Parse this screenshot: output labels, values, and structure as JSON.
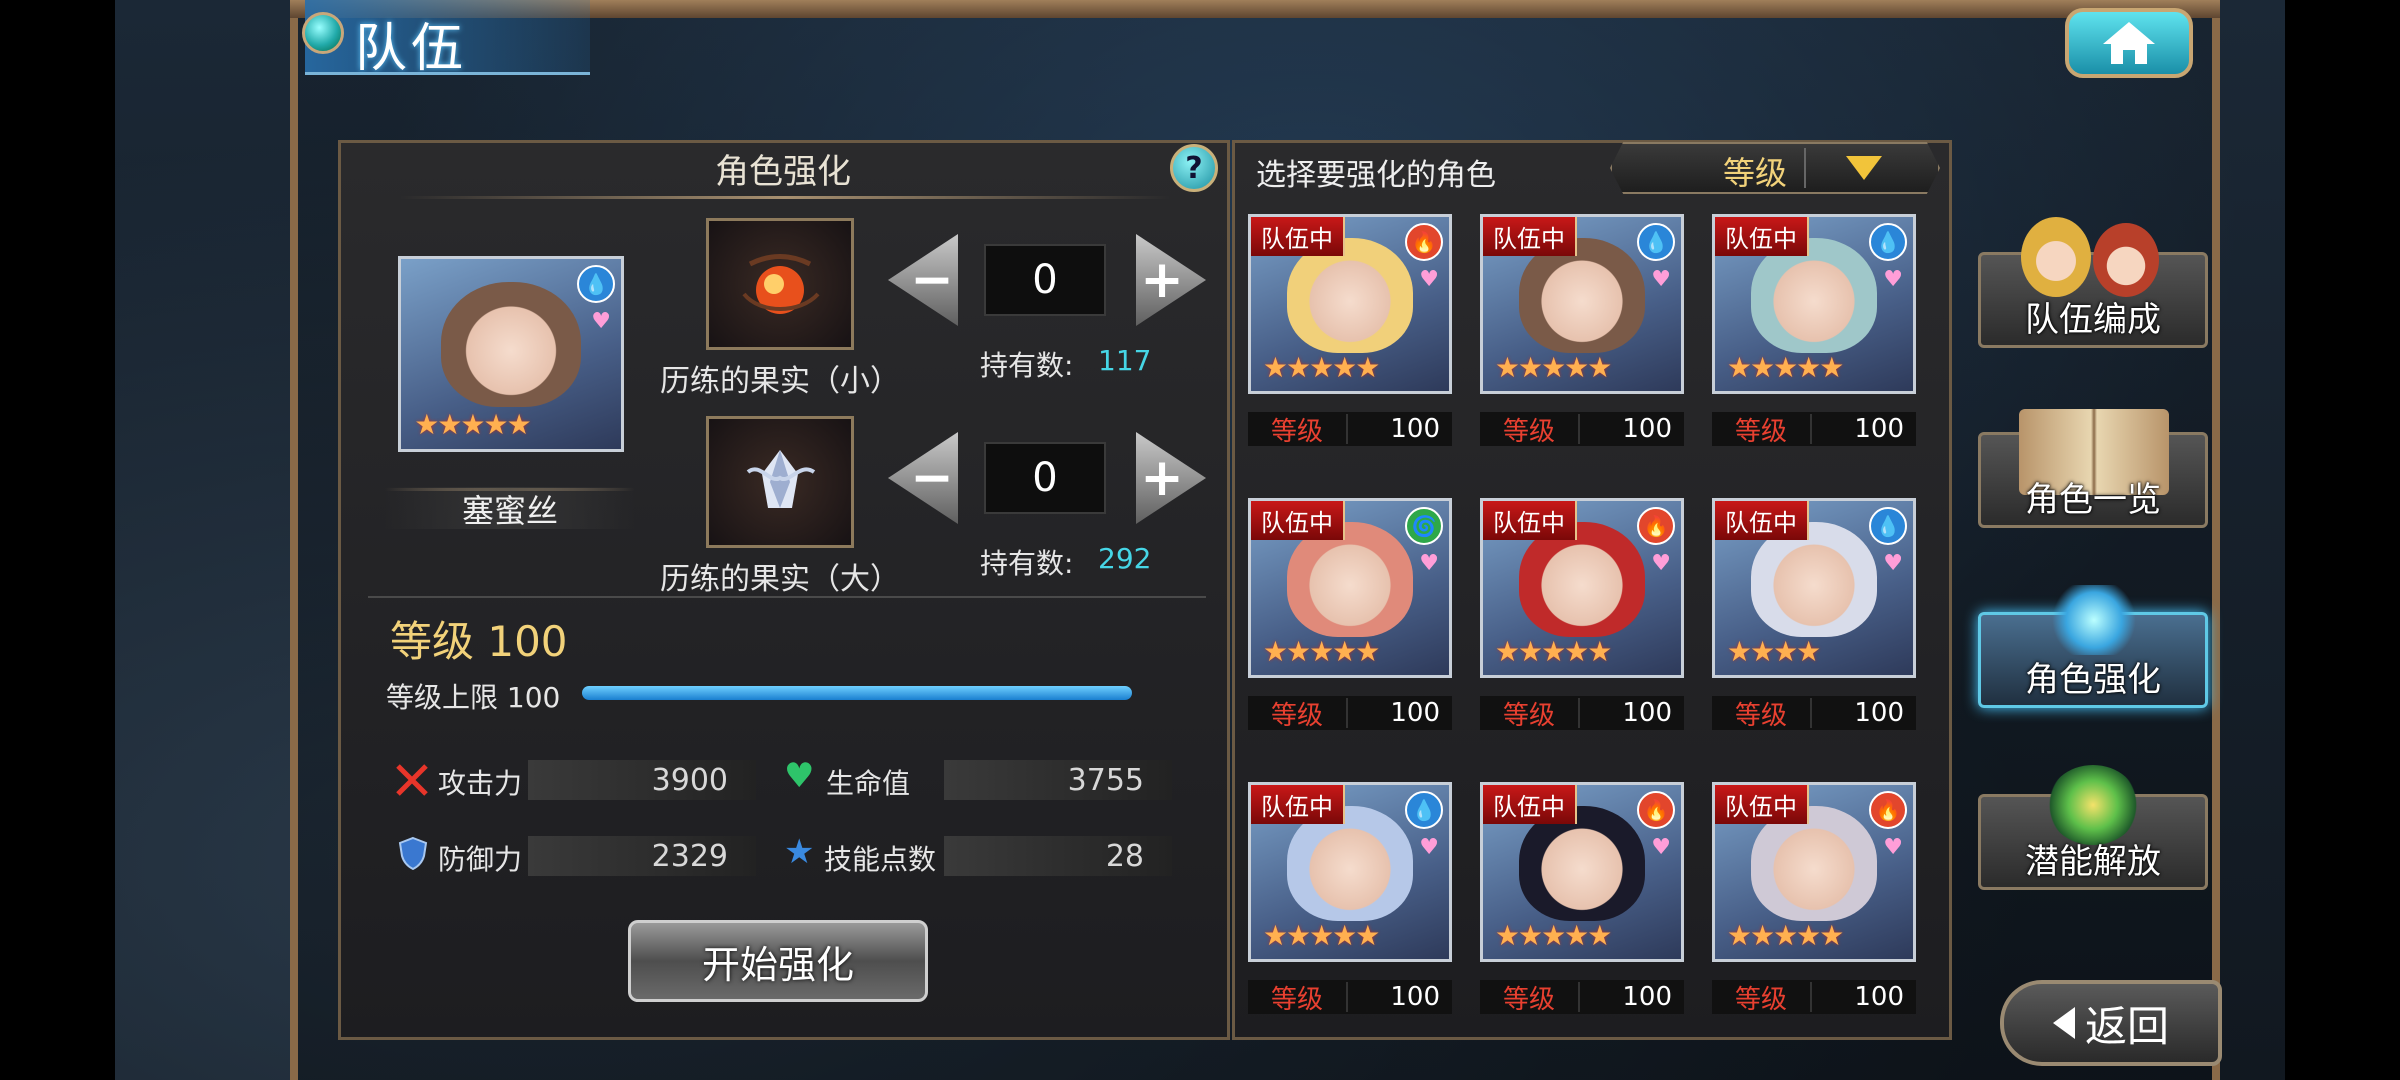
{
  "header": {
    "title": "队伍"
  },
  "enhance_panel": {
    "heading": "角色强化",
    "help_label": "?",
    "character_name": "塞蜜丝",
    "items": [
      {
        "name": "历练的果实（小）",
        "quantity": "0",
        "owned_label": "持有数:",
        "owned": "117"
      },
      {
        "name": "历练的果实（大）",
        "quantity": "0",
        "owned_label": "持有数:",
        "owned": "292"
      }
    ],
    "level_title": "等级 100",
    "level_cap_label": "等级上限 100",
    "level_progress": 1.0,
    "stats": {
      "attack_label": "攻击力",
      "attack": "3900",
      "hp_label": "生命值",
      "hp": "3755",
      "defense_label": "防御力",
      "defense": "2329",
      "skill_label": "技能点数",
      "skill": "28"
    },
    "start_button": "开始强化",
    "minus": "−",
    "plus": "+"
  },
  "select_panel": {
    "heading": "选择要强化的角色",
    "sort_value": "等级",
    "characters": [
      {
        "tag": "队伍中",
        "element": "fire",
        "level_label": "等级",
        "level": "100",
        "hair": "#f1d07a",
        "stars": "★★★★★"
      },
      {
        "tag": "队伍中",
        "element": "water",
        "level_label": "等级",
        "level": "100",
        "hair": "#7a5a48",
        "stars": "★★★★★"
      },
      {
        "tag": "队伍中",
        "element": "water",
        "level_label": "等级",
        "level": "100",
        "hair": "#9fc7c9",
        "stars": "★★★★★"
      },
      {
        "tag": "队伍中",
        "element": "wind",
        "level_label": "等级",
        "level": "100",
        "hair": "#e08a7a",
        "stars": "★★★★★"
      },
      {
        "tag": "队伍中",
        "element": "fire",
        "level_label": "等级",
        "level": "100",
        "hair": "#c02a2a",
        "stars": "★★★★★"
      },
      {
        "tag": "队伍中",
        "element": "water",
        "level_label": "等级",
        "level": "100",
        "hair": "#d8dcea",
        "stars": "★★★★"
      },
      {
        "tag": "队伍中",
        "element": "water",
        "level_label": "等级",
        "level": "100",
        "hair": "#b6c8e8",
        "stars": "★★★★★"
      },
      {
        "tag": "队伍中",
        "element": "fire",
        "level_label": "等级",
        "level": "100",
        "hair": "#1a1a2a",
        "stars": "★★★★★"
      },
      {
        "tag": "队伍中",
        "element": "fire",
        "level_label": "等级",
        "level": "100",
        "hair": "#cfc9d6",
        "stars": "★★★★★"
      }
    ]
  },
  "side_menu": [
    {
      "label": "队伍编成",
      "active": false
    },
    {
      "label": "角色一览",
      "active": false
    },
    {
      "label": "角色强化",
      "active": true
    },
    {
      "label": "潜能解放",
      "active": false
    }
  ],
  "back_button": "返回",
  "colors": {
    "fire": "#e2462c",
    "water": "#2a86d8",
    "wind": "#2ea84a",
    "accent": "#34a8e8",
    "owned": "#46d6e6",
    "level_gold": "#f2d27a"
  }
}
